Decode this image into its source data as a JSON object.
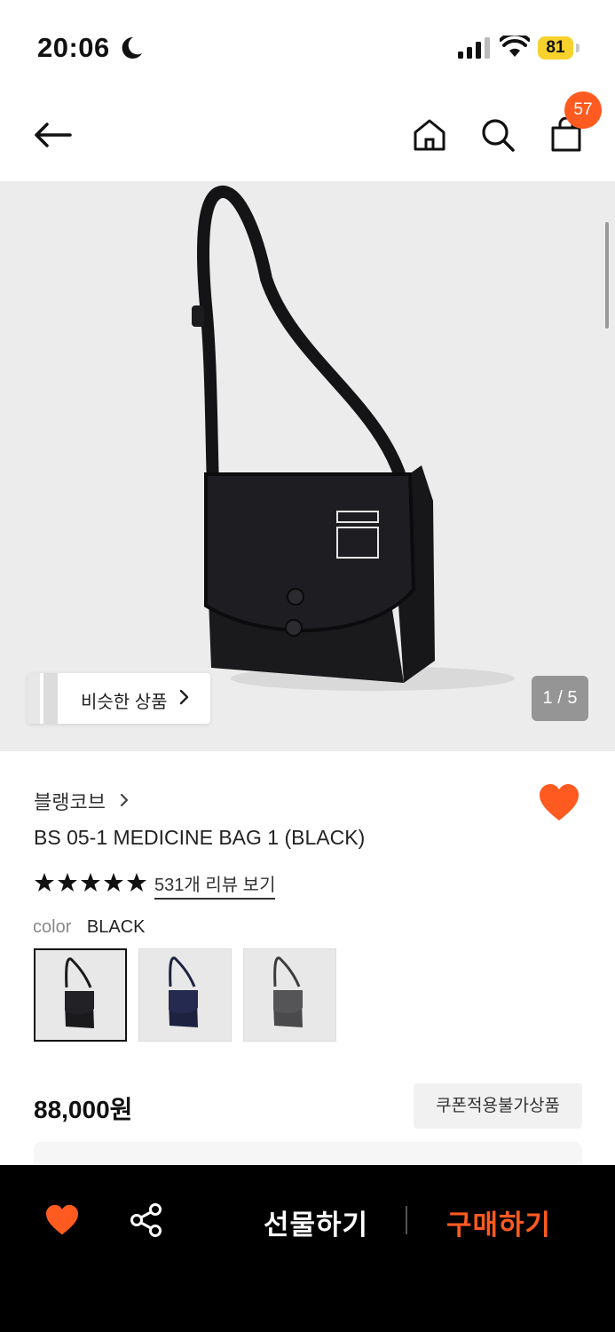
{
  "status_bar": {
    "time": "20:06",
    "battery": "81"
  },
  "header": {
    "cart_count": "57"
  },
  "gallery": {
    "similar_label": "비슷한 상품",
    "counter": "1 / 5"
  },
  "product": {
    "brand": "블랭코브",
    "title": "BS 05-1 MEDICINE BAG 1 (BLACK)",
    "rating": 5,
    "review_link": "531개 리뷰 보기",
    "color_label": "color",
    "color_value": "BLACK",
    "swatches": [
      {
        "color": "#1a1a1d",
        "selected": true
      },
      {
        "color": "#1d2240",
        "selected": false
      },
      {
        "color": "#4a4a4c",
        "selected": false
      }
    ],
    "price": "88,000원",
    "coupon_label": "쿠폰적용불가상품"
  },
  "bottom_bar": {
    "gift_label": "선물하기",
    "buy_label": "구매하기"
  },
  "colors": {
    "accent": "#ff5a1f",
    "bar_bg": "#000000"
  }
}
